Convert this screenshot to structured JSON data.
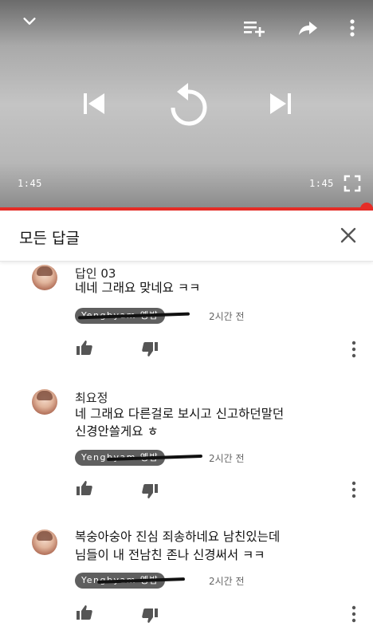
{
  "player": {
    "current_time": "1:45",
    "duration": "1:45",
    "progress": 1.0,
    "accent_color": "#e52d27"
  },
  "replies_header": {
    "title": "모든 답글"
  },
  "comments": [
    {
      "author": "답인 03",
      "lines": [
        "네네 그래요 맞네요 ㅋㅋ"
      ],
      "mention": "Yengbyam 옝뱜",
      "time": "2시간 전"
    },
    {
      "author": "최요정",
      "lines": [
        "네 그래요 다른걸로 보시고 신고하던말던",
        "신경안쓸게요 ㅎ"
      ],
      "mention": "Yengbyam 옝뱜",
      "time": "2시간 전"
    },
    {
      "author": "",
      "lines": [
        "복숭아숭아 진심 죄송하네요 남친있는데",
        "님들이 내 전남친 존나 신경써서 ㅋㅋ"
      ],
      "mention": "Yengbyam 옝뱜",
      "time": "2시간 전"
    }
  ],
  "icons": {
    "collapse": "chevron-down-icon",
    "add_to_queue": "playlist-add-icon",
    "share": "share-icon",
    "more": "more-vert-icon",
    "previous": "skip-previous-icon",
    "replay": "replay-icon",
    "next": "skip-next-icon",
    "fullscreen": "fullscreen-icon",
    "close": "close-icon",
    "like": "thumb-up-icon",
    "dislike": "thumb-down-icon"
  }
}
